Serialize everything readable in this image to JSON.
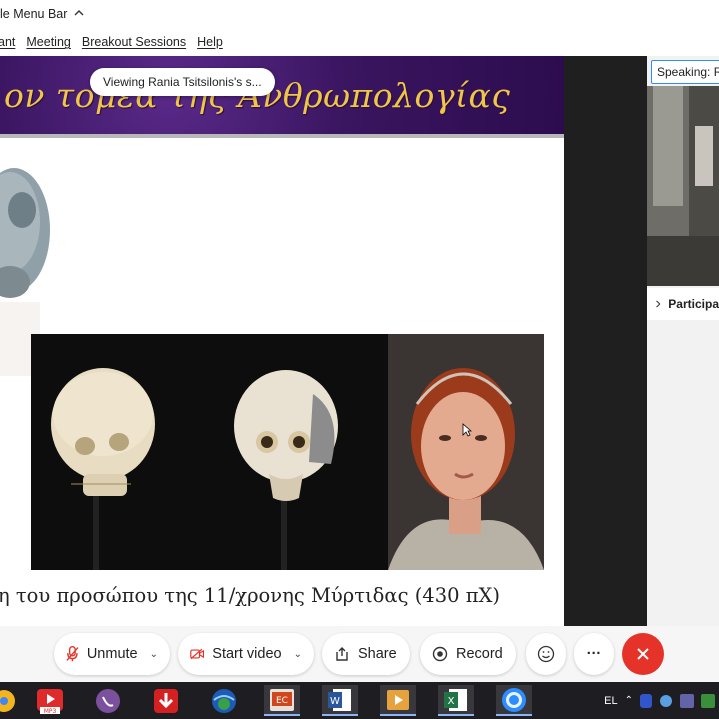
{
  "window": {
    "title": "le Menu Bar",
    "minimize_chevron": "chevron-up"
  },
  "menu": {
    "items": [
      "ant",
      "Meeting",
      "Breakout Sessions",
      "Help"
    ]
  },
  "share": {
    "viewing_pill": "Viewing Rania Tsitsilonis's s...",
    "slide_heading": "ον τομέα της Ανθρωπολογίας",
    "caption": "η του προσώπου της 11/χρονης Μύρτιδας (430 πΧ)"
  },
  "sidebar": {
    "speaking_label": "Speaking: R",
    "participants_label": "Participa"
  },
  "toolbar": {
    "unmute_label": "Unmute",
    "start_video_label": "Start video",
    "share_label": "Share",
    "record_label": "Record",
    "more_label": "···"
  },
  "taskbar": {
    "language": "EL",
    "apps": [
      "chrome",
      "mp3-converter",
      "viber",
      "downloader",
      "google-earth",
      "office",
      "word",
      "media-player",
      "excel",
      "zoom"
    ]
  },
  "colors": {
    "accent": "#2d8cff",
    "end_button": "#e5332a",
    "banner": "#3a1560",
    "heading_text": "#f0c648"
  }
}
